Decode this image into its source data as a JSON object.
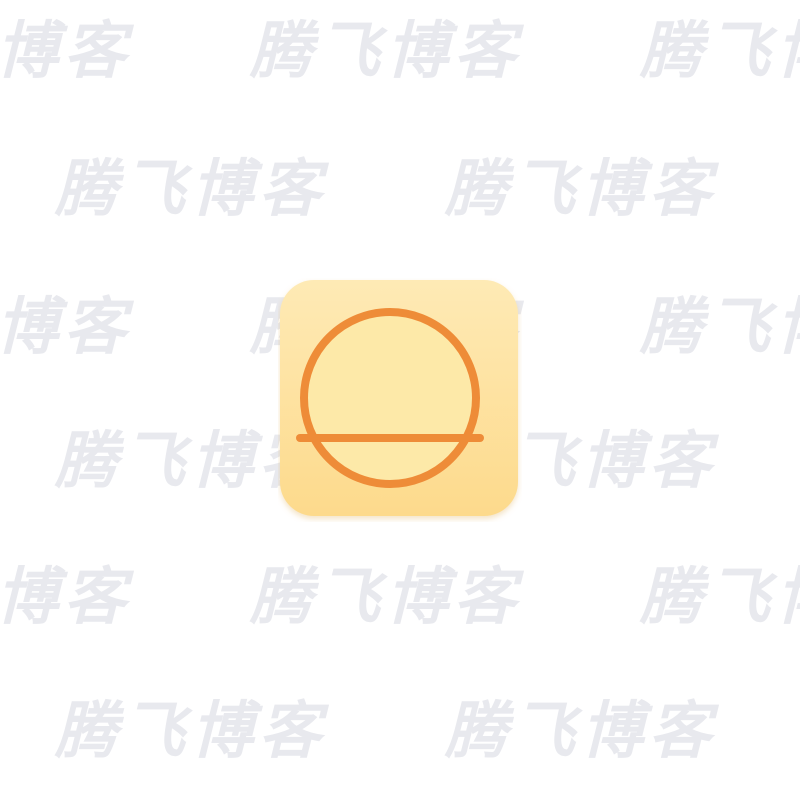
{
  "watermark": {
    "text": "腾飞博客"
  },
  "icon": {
    "name": "split-circle-app-icon",
    "background_color": "#FDDA8C",
    "background_highlight": "#FEEAB5",
    "ring_color": "#EE8C38",
    "inner_fill": "#FDE9A8"
  }
}
